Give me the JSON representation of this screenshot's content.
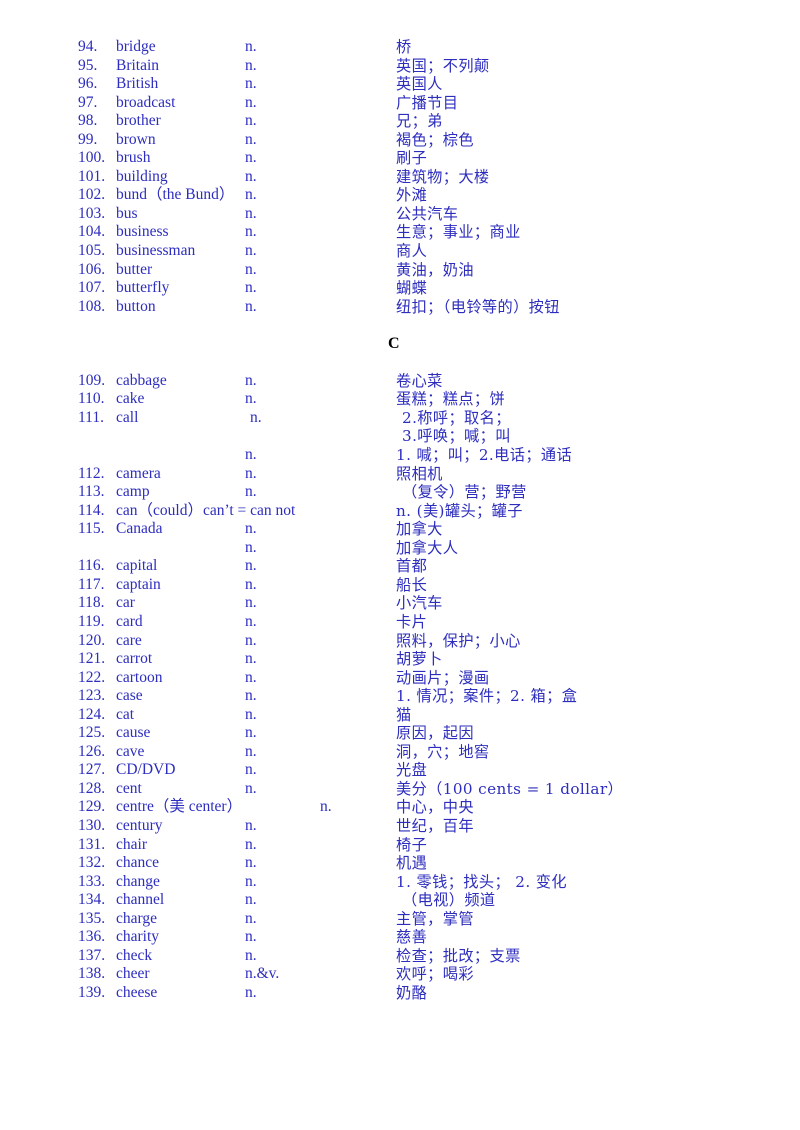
{
  "document": {
    "title": "English Vocabulary List B-C",
    "text_color": "#2d2dbe",
    "heading_color": "#000000"
  },
  "sections": [
    {
      "letter": "",
      "show_header": false,
      "entries": [
        {
          "num": "94.",
          "word": "bridge",
          "pos": "n.",
          "cn": "桥"
        },
        {
          "num": "95.",
          "word": "Britain",
          "pos": "n.",
          "cn": "英国；不列颠"
        },
        {
          "num": "96.",
          "word": "British",
          "pos": "n.",
          "cn": "英国人"
        },
        {
          "num": "97.",
          "word": "broadcast",
          "pos": "n.",
          "cn": "广播节目"
        },
        {
          "num": "98.",
          "word": "brother",
          "pos": "n.",
          "cn": "兄；弟"
        },
        {
          "num": "99.",
          "word": "brown",
          "pos": "n.",
          "cn": "褐色；棕色"
        },
        {
          "num": "100.",
          "word": "brush",
          "pos": "n.",
          "cn": "刷子"
        },
        {
          "num": "101.",
          "word": "building",
          "pos": "n.",
          "cn": "建筑物；大楼"
        },
        {
          "num": "102.",
          "word": "bund（the Bund）",
          "pos": "n.",
          "cn": "外滩"
        },
        {
          "num": "103.",
          "word": "bus",
          "pos": "n.",
          "cn": "公共汽车"
        },
        {
          "num": "104.",
          "word": "business",
          "pos": "n.",
          "cn": "生意；事业；商业"
        },
        {
          "num": "105.",
          "word": "businessman",
          "pos": "n.",
          "cn": "商人"
        },
        {
          "num": "106.",
          "word": "butter",
          "pos": "n.",
          "cn": "黄油，奶油"
        },
        {
          "num": "107.",
          "word": "butterfly",
          "pos": "n.",
          "cn": "蝴蝶"
        },
        {
          "num": "108.",
          "word": "button",
          "pos": "n.",
          "cn": "纽扣；（电铃等的）按钮"
        }
      ]
    },
    {
      "letter": "C",
      "show_header": true,
      "entries": [
        {
          "num": "109.",
          "word": "cabbage",
          "pos": "n.",
          "cn": "卷心菜"
        },
        {
          "num": "110.",
          "word": "cake",
          "pos": "n.",
          "cn": "蛋糕；糕点；饼"
        },
        {
          "num": "111.",
          "word": "call",
          "pos": "n.",
          "pos_indent": true,
          "cn": "2.称呼；取名；",
          "cn_indent": true
        },
        {
          "num": "",
          "word": "",
          "pos": "",
          "cn": "3.呼唤；喊；叫",
          "cn_indent": true
        },
        {
          "num": "",
          "word": "",
          "pos": "n.",
          "cn": "1. 喊；叫；2.电话；通话"
        },
        {
          "num": "112.",
          "word": "camera",
          "pos": "n.",
          "cn": "照相机"
        },
        {
          "num": "113.",
          "word": "camp",
          "pos": "n.",
          "cn": "（复令）营；野营",
          "cn_indent": true
        },
        {
          "num": "114.",
          "word": "can（could）can’t = can not",
          "pos": "",
          "word_wide": true,
          "cn": "n. (美)罐头；罐子"
        },
        {
          "num": "115.",
          "word": "Canada",
          "pos": "n.",
          "cn": "加拿大"
        },
        {
          "num": "",
          "word": "",
          "pos": "n.",
          "cn": "加拿大人"
        },
        {
          "num": "116.",
          "word": "capital",
          "pos": "n.",
          "cn": "首都"
        },
        {
          "num": "117.",
          "word": "captain",
          "pos": "n.",
          "cn": "船长"
        },
        {
          "num": "118.",
          "word": "car",
          "pos": "n.",
          "cn": "小汽车"
        },
        {
          "num": "119.",
          "word": "card",
          "pos": "n.",
          "cn": "卡片"
        },
        {
          "num": "120.",
          "word": "care",
          "pos": "n.",
          "cn": "照料，保护；小心"
        },
        {
          "num": "121.",
          "word": "carrot",
          "pos": "n.",
          "cn": "胡萝卜"
        },
        {
          "num": "122.",
          "word": "cartoon",
          "pos": "n.",
          "cn": "动画片；漫画"
        },
        {
          "num": "123.",
          "word": "case",
          "pos": "n.",
          "cn": "1. 情况；案件；2. 箱；盒"
        },
        {
          "num": "124.",
          "word": "cat",
          "pos": "n.",
          "cn": "猫"
        },
        {
          "num": "125.",
          "word": "cause",
          "pos": "n.",
          "cn": "原因，起因"
        },
        {
          "num": "126.",
          "word": "cave",
          "pos": "n.",
          "cn": "洞，穴；地窖"
        },
        {
          "num": "127.",
          "word": "CD/DVD",
          "pos": "n.",
          "cn": "光盘"
        },
        {
          "num": "128.",
          "word": "cent",
          "pos": "n.",
          "cn": "美分（100 cents = 1 dollar）"
        },
        {
          "num": "129.",
          "word": "centre（美 center）",
          "pos": "n.",
          "pos_wide": true,
          "cn": "中心，中央"
        },
        {
          "num": "130.",
          "word": "century",
          "pos": "n.",
          "cn": "世纪，百年"
        },
        {
          "num": "131.",
          "word": "chair",
          "pos": "n.",
          "cn": "椅子"
        },
        {
          "num": "132.",
          "word": "chance",
          "pos": "n.",
          "cn": "机遇"
        },
        {
          "num": "133.",
          "word": "change",
          "pos": "n.",
          "cn": "1. 零钱；找头； 2. 变化"
        },
        {
          "num": "134.",
          "word": "channel",
          "pos": "n.",
          "cn": "（电视）频道",
          "cn_indent": true
        },
        {
          "num": "135.",
          "word": "charge",
          "pos": "n.",
          "cn": "主管，掌管"
        },
        {
          "num": "136.",
          "word": "charity",
          "pos": "n.",
          "cn": "慈善"
        },
        {
          "num": "137.",
          "word": "check",
          "pos": "n.",
          "cn": "检查；批改；支票"
        },
        {
          "num": "138.",
          "word": "cheer",
          "pos": "n.&v.",
          "cn": "欢呼；喝彩"
        },
        {
          "num": "139.",
          "word": "cheese",
          "pos": "n.",
          "cn": "奶酪"
        }
      ]
    }
  ]
}
